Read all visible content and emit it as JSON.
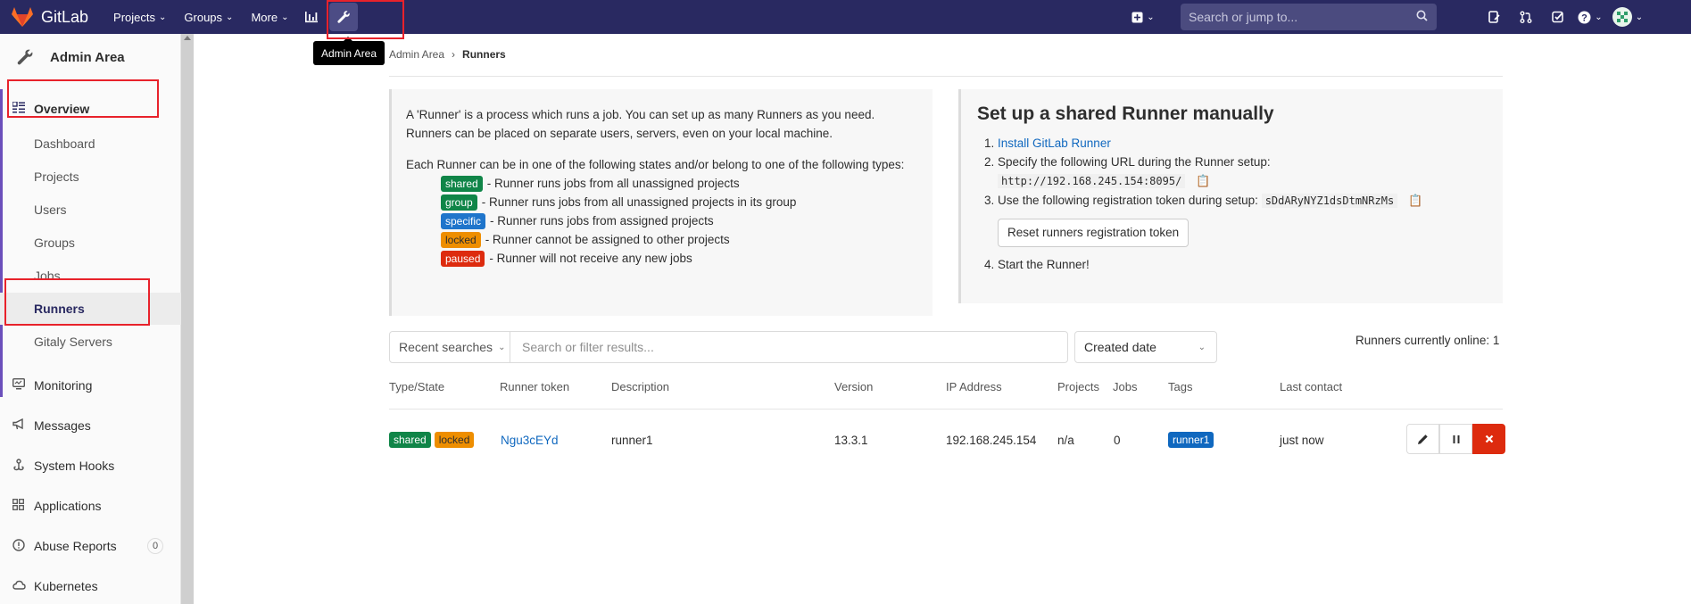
{
  "navbar": {
    "brand": "GitLab",
    "menus": [
      {
        "label": "Projects"
      },
      {
        "label": "Groups"
      },
      {
        "label": "More"
      }
    ],
    "search_placeholder": "Search or jump to..."
  },
  "tooltip": "Admin Area",
  "sidebar": {
    "title": "Admin Area",
    "overview_label": "Overview",
    "sub_items": [
      "Dashboard",
      "Projects",
      "Users",
      "Groups",
      "Jobs",
      "Runners",
      "Gitaly Servers"
    ],
    "items": [
      "Monitoring",
      "Messages",
      "System Hooks",
      "Applications",
      "Abuse Reports",
      "Kubernetes"
    ],
    "abuse_count": "0"
  },
  "breadcrumb": {
    "parent": "Admin Area",
    "current": "Runners"
  },
  "info": {
    "intro": "A 'Runner' is a process which runs a job. You can set up as many Runners as you need. Runners can be placed on separate users, servers, even on your local machine.",
    "states_intro": "Each Runner can be in one of the following states and/or belong to one of the following types:",
    "states": [
      {
        "tag": "shared",
        "text": "- Runner runs jobs from all unassigned projects"
      },
      {
        "tag": "group",
        "text": "- Runner runs jobs from all unassigned projects in its group"
      },
      {
        "tag": "specific",
        "text": "- Runner runs jobs from assigned projects"
      },
      {
        "tag": "locked",
        "text": "- Runner cannot be assigned to other projects"
      },
      {
        "tag": "paused",
        "text": "- Runner will not receive any new jobs"
      }
    ]
  },
  "setup": {
    "title": "Set up a shared Runner manually",
    "step1_link": "Install GitLab Runner",
    "step2_text": "Specify the following URL during the Runner setup:",
    "url": "http://192.168.245.154:8095/",
    "step3_text": "Use the following registration token during setup:",
    "token": "sDdARyNYZ1dsDtmNRzMs",
    "reset_button": "Reset runners registration token",
    "step4_text": "Start the Runner!"
  },
  "filter": {
    "recent_label": "Recent searches",
    "placeholder": "Search or filter results...",
    "sort_label": "Created date",
    "online_text": "Runners currently online: 1"
  },
  "table": {
    "headers": [
      "Type/State",
      "Runner token",
      "Description",
      "Version",
      "IP Address",
      "Projects",
      "Jobs",
      "Tags",
      "Last contact"
    ],
    "row": {
      "states": [
        "shared",
        "locked"
      ],
      "token": "Ngu3cEYd",
      "description": "runner1",
      "version": "13.3.1",
      "ip": "192.168.245.154",
      "projects": "n/a",
      "jobs": "0",
      "tag": "runner1",
      "last_contact": "just now"
    }
  },
  "colors": {
    "navbar": "#292961",
    "annotation": "#e8222b",
    "link": "#1068bf"
  }
}
